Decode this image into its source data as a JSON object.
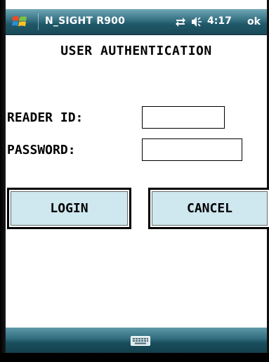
{
  "titlebar": {
    "app_title": "N_SIGHT R900",
    "time": "4:17",
    "ok_label": "ok",
    "icons": [
      "windows-start-icon",
      "connectivity-icon",
      "volume-icon"
    ]
  },
  "form": {
    "heading": "USER AUTHENTICATION",
    "reader_id_label": "READER ID:",
    "reader_id_value": "",
    "password_label": "PASSWORD:",
    "password_value": ""
  },
  "buttons": {
    "login_label": "LOGIN",
    "cancel_label": "CANCEL"
  },
  "menubar": {
    "icons": [
      "keyboard-icon"
    ]
  },
  "colors": {
    "titlebar": "#2f6b7c",
    "button_face": "#cfe7ef",
    "background": "#ffffff"
  }
}
